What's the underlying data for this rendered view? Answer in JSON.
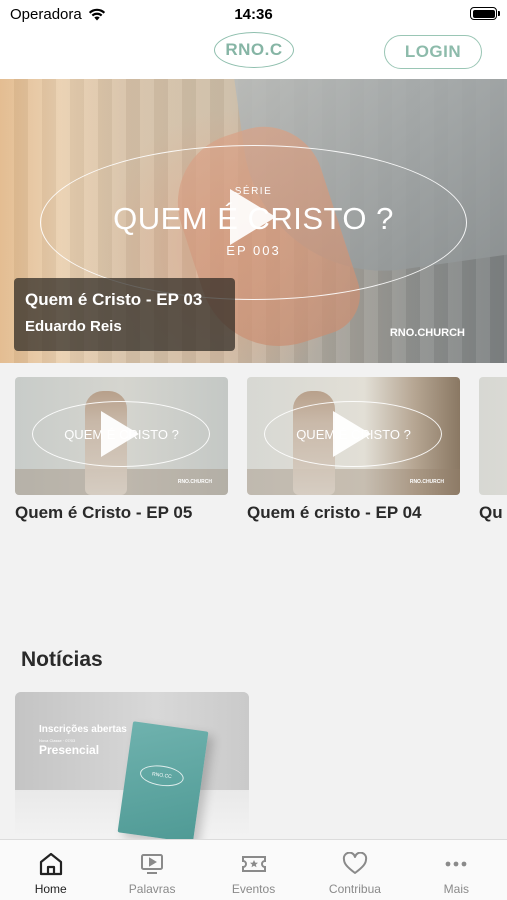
{
  "status_bar": {
    "carrier": "Operadora",
    "time": "14:36"
  },
  "header": {
    "logo": "RNO.C",
    "login_label": "LOGIN"
  },
  "hero": {
    "serie_label": "SÉRIE",
    "series_title": "QUEM É CRISTO ?",
    "episode_code": "EP 003",
    "brand": "RNO.CHURCH",
    "card_title": "Quem é Cristo - EP 03",
    "card_speaker": "Eduardo Reis"
  },
  "episodes": [
    {
      "thumb_text": "QUEM É CRISTO ?",
      "brand": "RNO.CHURCH",
      "title": "Quem é Cristo - EP 05"
    },
    {
      "thumb_text": "QUEM É CRISTO ?",
      "brand": "RNO.CHURCH",
      "title": "Quem é cristo - EP 04"
    },
    {
      "title": "Qu"
    }
  ],
  "news": {
    "heading": "Notícias",
    "card": {
      "line1": "Inscrições abertas",
      "line2": "Nova Classe · 07/03",
      "line3": "Presencial",
      "book_label": "RNO.CC"
    }
  },
  "tabbar": [
    {
      "label": "Home",
      "icon": "home-icon",
      "active": true
    },
    {
      "label": "Palavras",
      "icon": "play-screen-icon",
      "active": false
    },
    {
      "label": "Eventos",
      "icon": "ticket-star-icon",
      "active": false
    },
    {
      "label": "Contribua",
      "icon": "heart-icon",
      "active": false
    },
    {
      "label": "Mais",
      "icon": "more-dots-icon",
      "active": false
    }
  ],
  "colors": {
    "brand_accent": "#8fbfae",
    "background": "#f2f2f2"
  }
}
